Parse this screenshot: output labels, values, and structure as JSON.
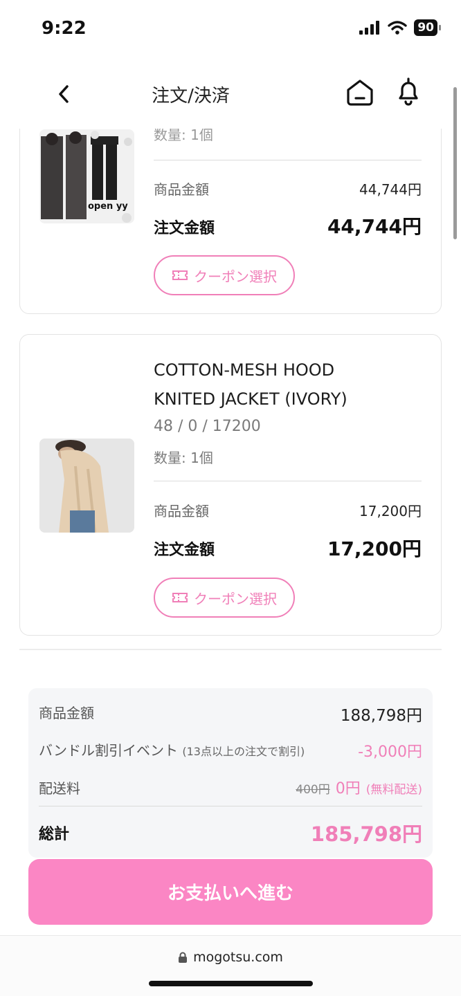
{
  "status_bar": {
    "time": "9:22",
    "battery": "90"
  },
  "header": {
    "title": "注文/決済"
  },
  "items": [
    {
      "quantity": "数量: 1個",
      "thumb_text": "open yy",
      "price_label": "商品金額",
      "price_value": "44,744円",
      "total_label": "注文金額",
      "total_value": "44,744円",
      "coupon_label": "クーポン選択"
    },
    {
      "name_line1": "COTTON-MESH HOOD",
      "name_line2": "KNITED JACKET (IVORY)",
      "option": "48 / 0 / 17200",
      "quantity": "数量: 1個",
      "price_label": "商品金額",
      "price_value": "17,200円",
      "total_label": "注文金額",
      "total_value": "17,200円",
      "coupon_label": "クーポン選択"
    }
  ],
  "summary": {
    "subtotal_label": "商品金額",
    "subtotal_value": "188,798円",
    "bundle_label": "バンドル割引イベント",
    "bundle_note": "(13点以上の注文で割引)",
    "bundle_value": "-3,000円",
    "shipping_label": "配送料",
    "shipping_original": "400円",
    "shipping_value": "0円",
    "shipping_note": "(無料配送)",
    "grand_label": "総計",
    "grand_value": "185,798円"
  },
  "pay_button": "お支払いへ進む",
  "browser": {
    "url": "mogotsu.com"
  },
  "colors": {
    "accent": "#f07fb8",
    "pay_button": "#fb86c4"
  }
}
